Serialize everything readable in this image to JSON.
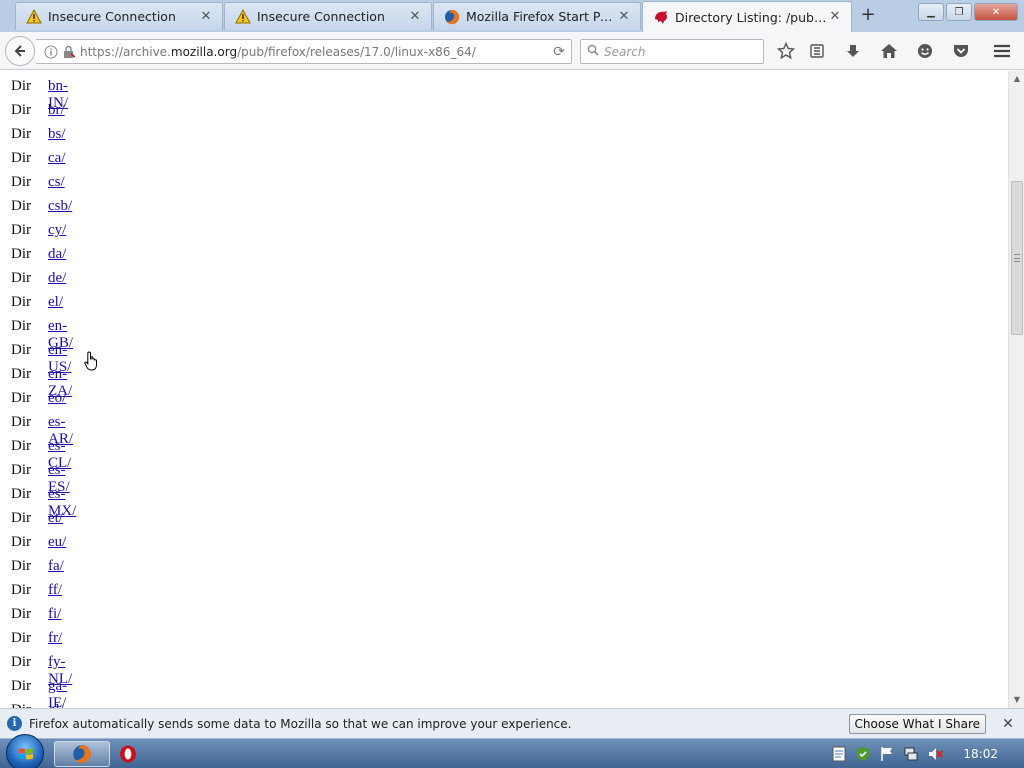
{
  "tabs": [
    {
      "label": "Insecure Connection",
      "icon": "warning-icon",
      "active": false
    },
    {
      "label": "Insecure Connection",
      "icon": "warning-icon",
      "active": false
    },
    {
      "label": "Mozilla Firefox Start Page",
      "icon": "firefox-icon",
      "active": false
    },
    {
      "label": "Directory Listing: /pub/fire...",
      "icon": "mozilla-dino-icon",
      "active": true
    }
  ],
  "new_tab_label": "+",
  "navbar": {
    "url_prefix": "https://archive.",
    "url_domain": "mozilla.org",
    "url_path": "/pub/firefox/releases/17.0/linux-x86_64/",
    "search_placeholder": "Search"
  },
  "listing": [
    {
      "type": "Dir",
      "name": "bn-IN/"
    },
    {
      "type": "Dir",
      "name": "br/"
    },
    {
      "type": "Dir",
      "name": "bs/"
    },
    {
      "type": "Dir",
      "name": "ca/"
    },
    {
      "type": "Dir",
      "name": "cs/"
    },
    {
      "type": "Dir",
      "name": "csb/"
    },
    {
      "type": "Dir",
      "name": "cy/"
    },
    {
      "type": "Dir",
      "name": "da/"
    },
    {
      "type": "Dir",
      "name": "de/"
    },
    {
      "type": "Dir",
      "name": "el/"
    },
    {
      "type": "Dir",
      "name": "en-GB/"
    },
    {
      "type": "Dir",
      "name": "en-US/"
    },
    {
      "type": "Dir",
      "name": "en-ZA/"
    },
    {
      "type": "Dir",
      "name": "eo/"
    },
    {
      "type": "Dir",
      "name": "es-AR/"
    },
    {
      "type": "Dir",
      "name": "es-CL/"
    },
    {
      "type": "Dir",
      "name": "es-ES/"
    },
    {
      "type": "Dir",
      "name": "es-MX/"
    },
    {
      "type": "Dir",
      "name": "et/"
    },
    {
      "type": "Dir",
      "name": "eu/"
    },
    {
      "type": "Dir",
      "name": "fa/"
    },
    {
      "type": "Dir",
      "name": "ff/"
    },
    {
      "type": "Dir",
      "name": "fi/"
    },
    {
      "type": "Dir",
      "name": "fr/"
    },
    {
      "type": "Dir",
      "name": "fy-NL/"
    },
    {
      "type": "Dir",
      "name": "ga-IE/"
    },
    {
      "type": "Dir",
      "name": "gl/"
    }
  ],
  "notification": {
    "text": "Firefox automatically sends some data to Mozilla so that we can improve your experience.",
    "button_label": "Choose What I Share"
  },
  "taskbar": {
    "clock": "18:02"
  },
  "colors": {
    "link": "#1a0dab",
    "tabstrip": "#b9cde5",
    "taskbar": "#3f6593"
  }
}
